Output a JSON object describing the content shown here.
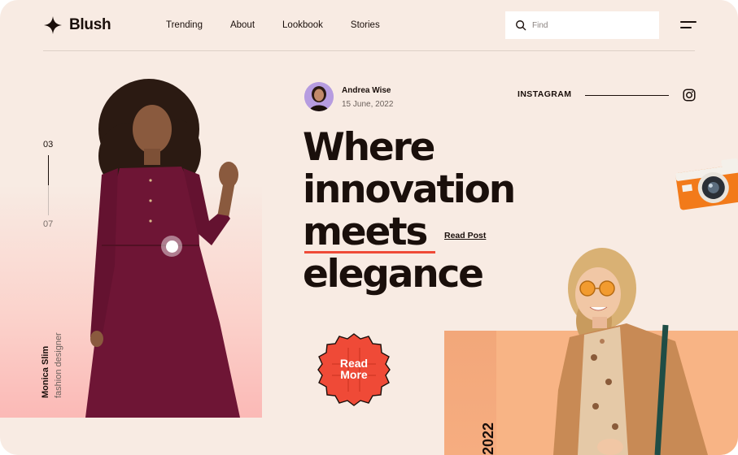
{
  "brand": {
    "name": "Blush"
  },
  "nav": {
    "items": [
      "Trending",
      "About",
      "Lookbook",
      "Stories"
    ]
  },
  "search": {
    "placeholder": "Find",
    "value": ""
  },
  "icons": {
    "logo": "four-point-star-icon",
    "search": "search-icon",
    "menu": "hamburger-menu-icon",
    "instagram": "instagram-icon"
  },
  "slider": {
    "current": "03",
    "total": "07"
  },
  "model": {
    "name": "Monica Slim",
    "role": "fashion designer"
  },
  "author": {
    "name": "Andrea Wise",
    "date": "15 June, 2022"
  },
  "social": {
    "label": "INSTAGRAM"
  },
  "hero": {
    "lines": [
      "Where",
      "innovation",
      "meets",
      "elegance"
    ],
    "read_post": "Read Post",
    "badge_line1": "Read",
    "badge_line2": "More"
  },
  "year": "2022",
  "colors": {
    "background": "#f8ebe3",
    "accent": "#ef4a37",
    "dress": "#6e1535",
    "peach": "#f8b485",
    "pink": "#fbb9b6",
    "text": "#1a0f0b"
  }
}
